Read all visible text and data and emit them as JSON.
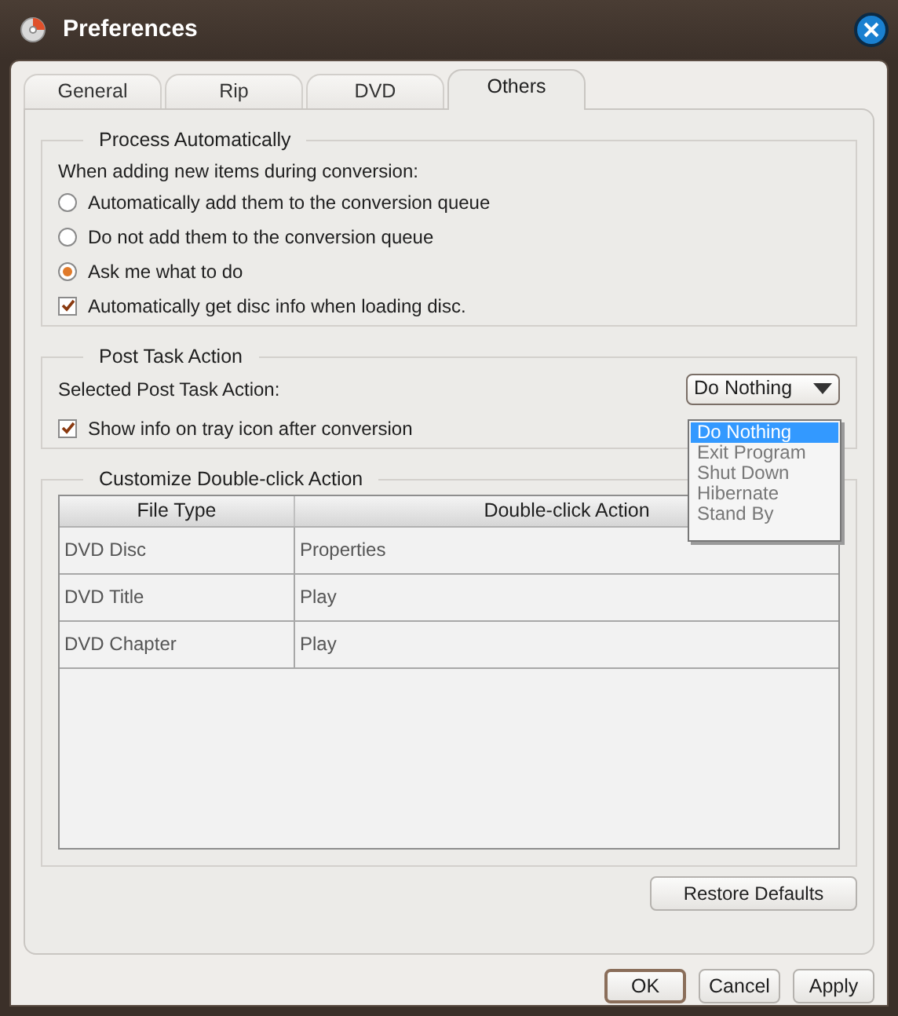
{
  "window": {
    "title": "Preferences"
  },
  "tabs": [
    {
      "label": "General",
      "selected": false
    },
    {
      "label": "Rip",
      "selected": false
    },
    {
      "label": "DVD",
      "selected": false
    },
    {
      "label": "Others",
      "selected": true
    }
  ],
  "process_automatically": {
    "title": "Process Automatically",
    "prompt": "When adding new items during conversion:",
    "options": [
      {
        "kind": "radio",
        "label": "Automatically add them to the conversion queue",
        "selected": false
      },
      {
        "kind": "radio",
        "label": "Do not add them to the conversion queue",
        "selected": false
      },
      {
        "kind": "radio",
        "label": "Ask me what to do",
        "selected": true
      },
      {
        "kind": "checkbox",
        "label": "Automatically get disc info when loading disc.",
        "checked": true
      }
    ]
  },
  "post_task_action": {
    "title": "Post Task Action",
    "label": "Selected Post Task Action:",
    "value": "Do Nothing",
    "dropdown_options": [
      {
        "label": "Do Nothing",
        "selected": true
      },
      {
        "label": "Exit Program",
        "selected": false
      },
      {
        "label": "Shut Down",
        "selected": false
      },
      {
        "label": "Hibernate",
        "selected": false
      },
      {
        "label": "Stand By",
        "selected": false
      }
    ],
    "show_tray_info": {
      "label": "Show info on tray icon after conversion",
      "checked": true
    }
  },
  "double_click_action": {
    "title": "Customize Double-click Action",
    "columns": [
      "File Type",
      "Double-click Action"
    ],
    "rows": [
      [
        "DVD Disc",
        "Properties"
      ],
      [
        "DVD Title",
        "Play"
      ],
      [
        "DVD Chapter",
        "Play"
      ]
    ]
  },
  "restore_defaults": "Restore Defaults",
  "buttons": [
    "OK",
    "Cancel",
    "Apply"
  ]
}
